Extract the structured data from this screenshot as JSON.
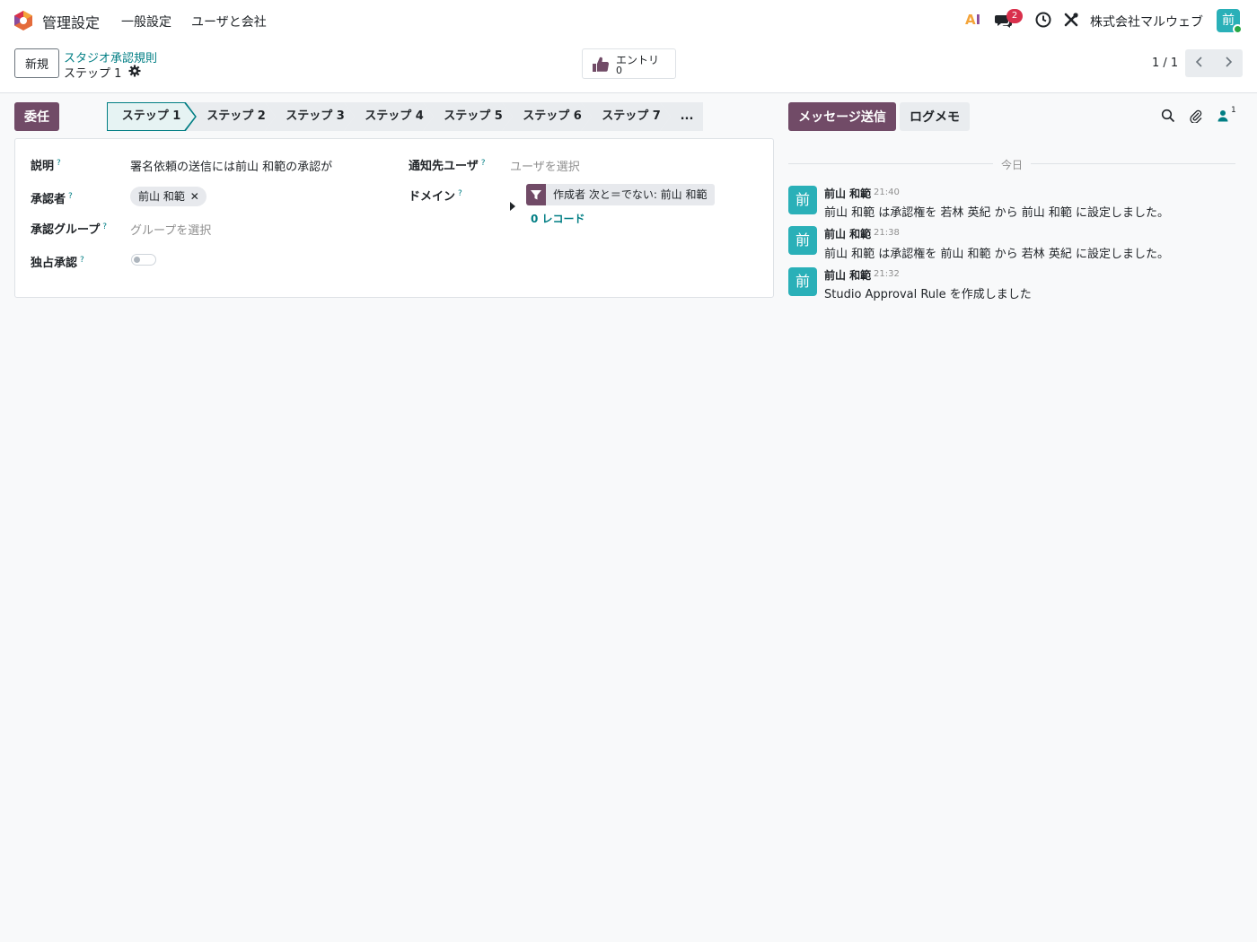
{
  "navbar": {
    "app_name": "管理設定",
    "menu": [
      "一般設定",
      "ユーザと会社"
    ],
    "ai_label": "AI",
    "message_badge": "2",
    "company": "株式会社マルウェブ",
    "avatar_initial": "前"
  },
  "control_panel": {
    "new_button": "新規",
    "breadcrumb": "スタジオ承認規則",
    "record_title": "ステップ 1",
    "entry_label": "エントリ",
    "entry_count": "0",
    "pager": "1 / 1"
  },
  "form": {
    "action_button": "委任",
    "stages": [
      "ステップ 1",
      "ステップ 2",
      "ステップ 3",
      "ステップ 4",
      "ステップ 5",
      "ステップ 6",
      "ステップ 7",
      "..."
    ],
    "active_stage": "ステップ 1",
    "help_mark": "?",
    "fields": {
      "description_label": "説明",
      "description_value": "署名依頼の送信には前山 和範の承認が",
      "approver_label": "承認者",
      "approver_tag": "前山 和範",
      "approver_tag_remove": "✕",
      "approval_group_label": "承認グループ",
      "approval_group_placeholder": "グループを選択",
      "exclusive_label": "独占承認",
      "exclusive_value": false,
      "notify_users_label": "通知先ユーザ",
      "notify_users_placeholder": "ユーザを選択",
      "domain_label": "ドメイン",
      "domain_filter": "作成者 次と＝でない: 前山 和範",
      "domain_records": "0 レコード"
    }
  },
  "chatter": {
    "send_message": "メッセージ送信",
    "log_note": "ログメモ",
    "follower_count": "1",
    "date_separator": "今日",
    "messages": [
      {
        "avatar": "前",
        "author": "前山 和範",
        "time": "21:40",
        "body": "前山 和範 は承認権を 若林 英紀 から 前山 和範 に設定しました。"
      },
      {
        "avatar": "前",
        "author": "前山 和範",
        "time": "21:38",
        "body": "前山 和範 は承認権を 前山 和範 から 若林 英紀 に設定しました。"
      },
      {
        "avatar": "前",
        "author": "前山 和範",
        "time": "21:32",
        "body": "Studio Approval Rule を作成しました"
      }
    ]
  },
  "colors": {
    "brand": "#714b67",
    "accent": "#017e84",
    "avatar": "#2ab0b8",
    "badge": "#d9304c"
  }
}
